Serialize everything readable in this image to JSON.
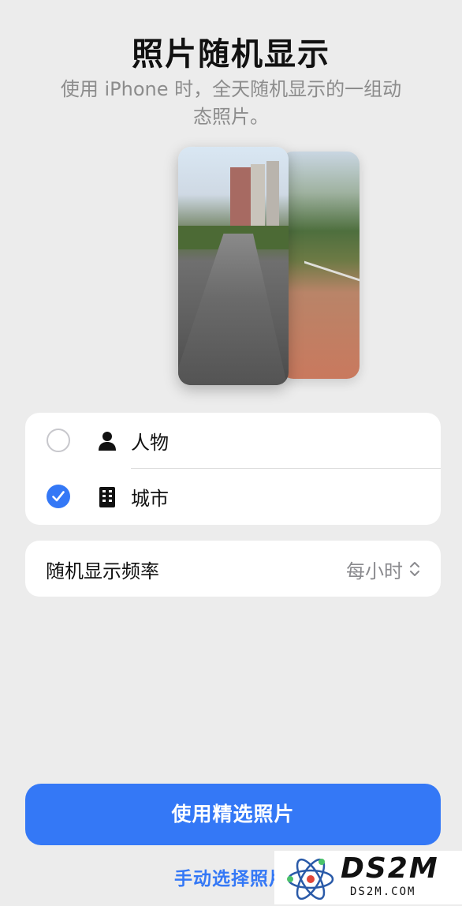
{
  "header": {
    "title": "照片随机显示",
    "subtitle": "使用 iPhone 时，全天随机显示的一组动态照片。"
  },
  "options": [
    {
      "label": "人物",
      "icon": "person-icon",
      "checked": false
    },
    {
      "label": "城市",
      "icon": "building-icon",
      "checked": true
    }
  ],
  "frequency": {
    "label": "随机显示频率",
    "value": "每小时"
  },
  "buttons": {
    "primary": "使用精选照片",
    "secondary": "手动选择照片"
  },
  "watermark": {
    "big": "DS2M",
    "small": "DS2M.COM"
  },
  "colors": {
    "accent": "#3478f6",
    "background": "#ececec",
    "card": "#ffffff"
  }
}
